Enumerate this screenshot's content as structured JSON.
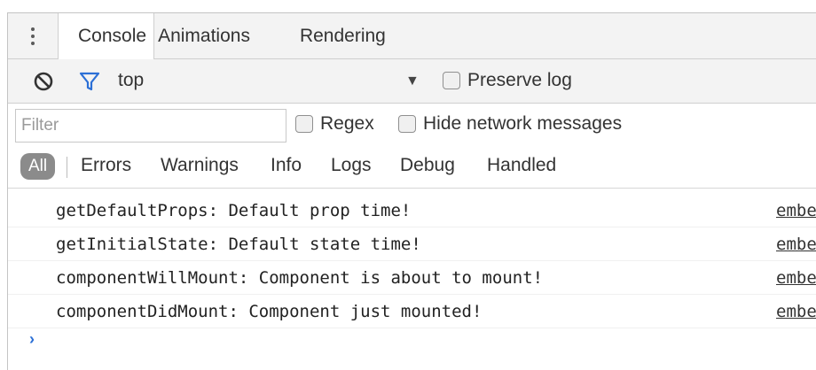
{
  "tabs": [
    {
      "label": "Console"
    },
    {
      "label": "Animations"
    },
    {
      "label": "Rendering"
    }
  ],
  "toolbar": {
    "context": "top",
    "context_arrow": "▼",
    "preserve_log_label": "Preserve log",
    "preserve_log_checked": false
  },
  "filter": {
    "placeholder": "Filter",
    "value": "",
    "regex_label": "Regex",
    "hide_network_label": "Hide network messages"
  },
  "levels": {
    "all": "All",
    "items": [
      "Errors",
      "Warnings",
      "Info",
      "Logs",
      "Debug",
      "Handled"
    ]
  },
  "messages": [
    {
      "text": "getDefaultProps: Default prop time!",
      "source": "embe"
    },
    {
      "text": "getInitialState: Default state time!",
      "source": "embe"
    },
    {
      "text": "componentWillMount: Component is about to mount!",
      "source": "embe"
    },
    {
      "text": "componentDidMount: Component just mounted!",
      "source": "embe"
    }
  ],
  "prompt": "›",
  "icons": {
    "menu": "kebab-menu-icon",
    "clear": "clear-console-icon",
    "filter": "filter-icon",
    "dropdown": "triangle-down-icon",
    "prompt": "chevron-right-icon"
  },
  "colors": {
    "filter_icon": "#2b6fd6",
    "all_badge": "#8b8b8b",
    "prompt": "#2b6fd6"
  }
}
